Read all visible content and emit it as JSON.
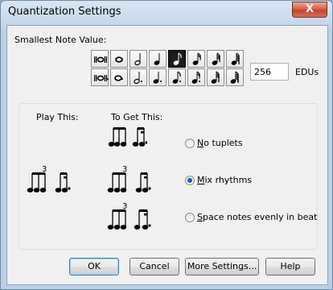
{
  "window": {
    "title": "Quantization Settings",
    "close_label": "X"
  },
  "smallest_note": {
    "label": "Smallest Note Value:",
    "row1": [
      "double-whole-note-icon",
      "whole-note-icon",
      "half-note-icon",
      "quarter-note-icon",
      "eighth-note-icon",
      "sixteenth-note-icon",
      "thirty-second-note-icon",
      "sixty-fourth-note-icon"
    ],
    "row2": [
      "dotted-double-whole-note-icon",
      "dotted-whole-note-icon",
      "dotted-half-note-icon",
      "dotted-quarter-note-icon",
      "dotted-eighth-note-icon",
      "dotted-sixteenth-note-icon",
      "dotted-thirty-second-note-icon",
      "dotted-sixty-fourth-note-icon"
    ],
    "selected": "eighth-note-icon",
    "edu_value": "256",
    "edu_label": "EDUs"
  },
  "options": {
    "play_this_label": "Play This:",
    "to_get_this_label": "To Get This:",
    "tuplet_number": "3",
    "radios": [
      {
        "label_prefix": "",
        "label_mnemonic": "N",
        "label_rest": "o tuplets",
        "checked": false
      },
      {
        "label_prefix": "",
        "label_mnemonic": "M",
        "label_rest": "ix rhythms",
        "checked": true
      },
      {
        "label_prefix": "",
        "label_mnemonic": "S",
        "label_rest": "pace notes evenly in beat",
        "checked": false
      }
    ]
  },
  "buttons": {
    "ok": "OK",
    "cancel": "Cancel",
    "more_settings": "More Settings...",
    "help": "Help"
  }
}
